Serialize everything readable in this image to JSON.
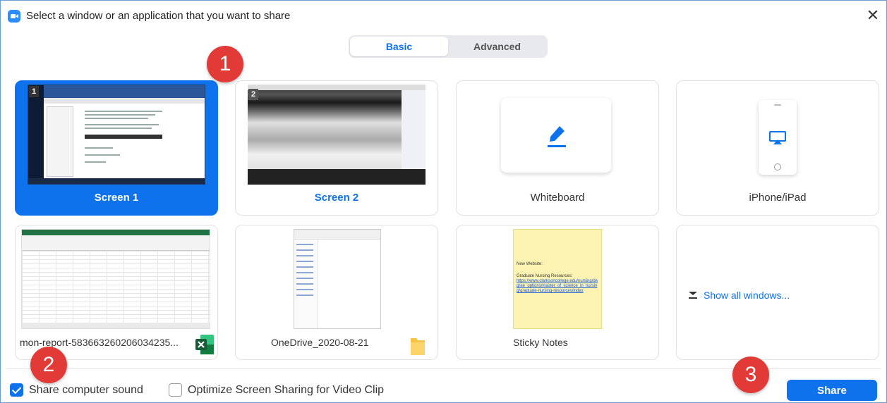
{
  "window": {
    "title": "Select a window or an application that you want to share",
    "close_glyph": "✕"
  },
  "tabs": [
    {
      "label": "Basic",
      "active": true
    },
    {
      "label": "Advanced",
      "active": false
    }
  ],
  "callouts": [
    "1",
    "2",
    "3"
  ],
  "tiles": {
    "screen1": {
      "label": "Screen 1",
      "badge": "1",
      "selected": true
    },
    "screen2": {
      "label": "Screen 2",
      "badge": "2"
    },
    "whiteboard": {
      "label": "Whiteboard",
      "icon": "pen-icon"
    },
    "iphone": {
      "label": "iPhone/iPad",
      "icon": "airplay-icon"
    },
    "excel": {
      "label": "mon-report-583663260206034235...",
      "icon": "excel-icon"
    },
    "onedrive": {
      "label": "OneDrive_2020-08-21",
      "icon": "folder-icon"
    },
    "sticky": {
      "label": "Sticky Notes",
      "note_line1": "New Website:",
      "note_line2": "Graduate Nursing Resources:",
      "note_link": "https://www.clarksoncollege.edu/nursing/degree_options/master_of_science_in_nursing/graduate-nursing-resources/index"
    },
    "show_all": {
      "label": "Show all windows...",
      "icon": "show-all-icon"
    }
  },
  "footer": {
    "share_sound": {
      "label": "Share computer sound",
      "checked": true
    },
    "optimize": {
      "label": "Optimize Screen Sharing for Video Clip",
      "checked": false
    },
    "share_button": "Share"
  },
  "colors": {
    "accent": "#0e72ed",
    "callout": "#e23b37",
    "excel_green": "#217346",
    "sticky_yellow": "#fdf3b2"
  }
}
